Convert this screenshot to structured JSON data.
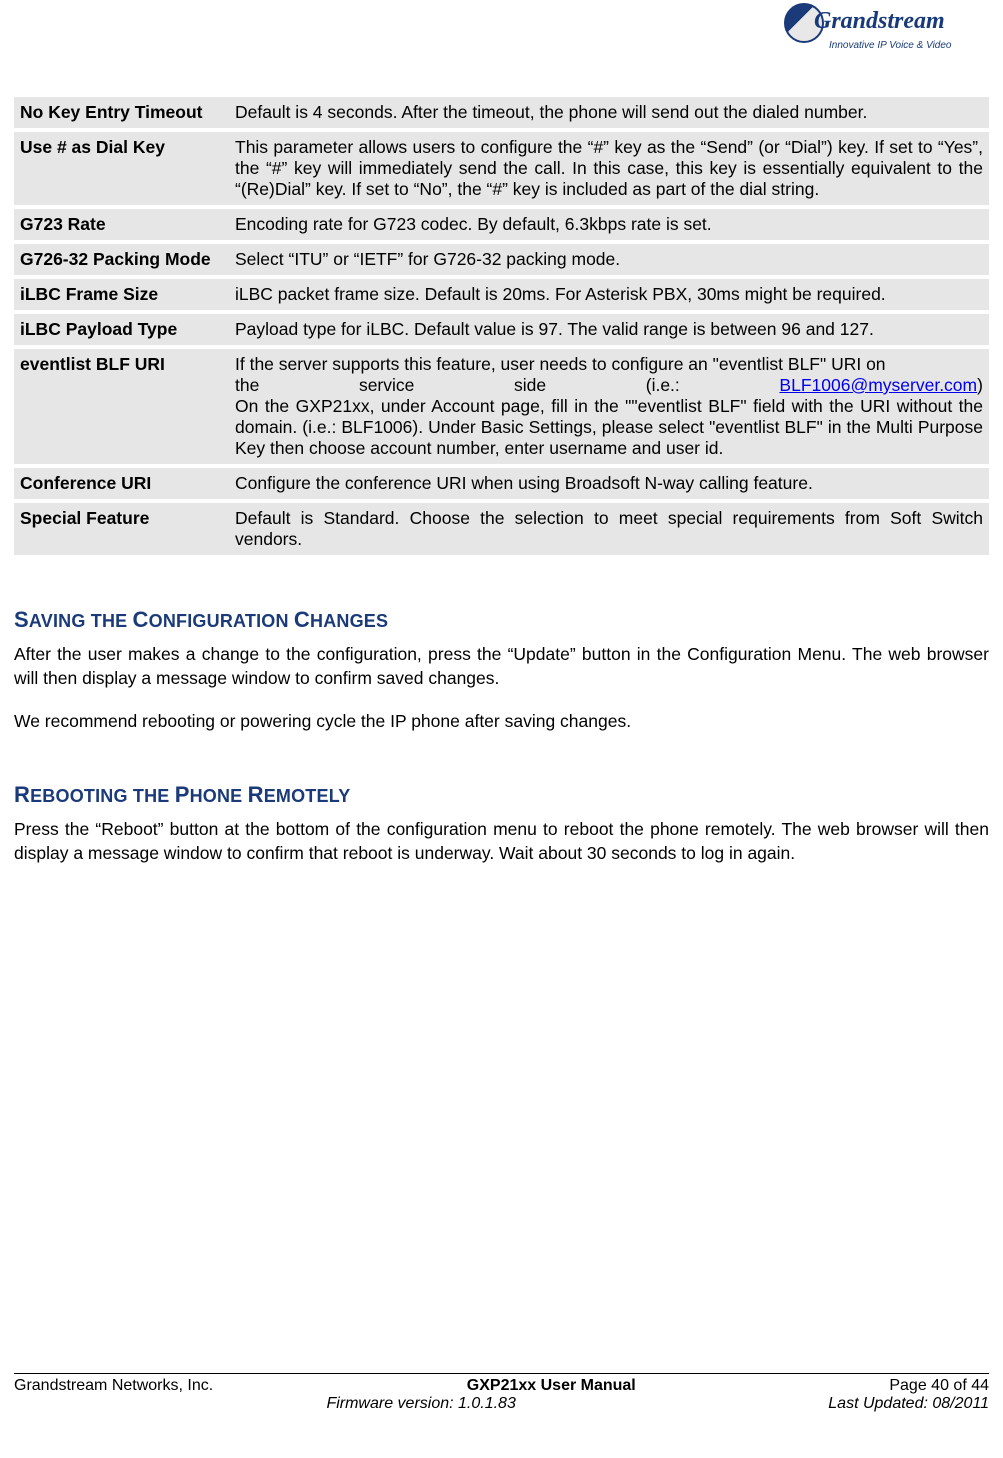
{
  "logo": {
    "brand": "Grandstream",
    "tagline": "Innovative IP Voice & Video"
  },
  "table": [
    {
      "label": "No Key Entry Timeout",
      "desc": "Default is 4 seconds. After the timeout, the phone will send out the dialed number."
    },
    {
      "label": "Use # as Dial Key",
      "desc": "This parameter allows users to configure the “#” key as the “Send” (or “Dial”) key. If set to “Yes”, the “#” key will immediately send the call. In this case, this key is essentially equivalent to the “(Re)Dial” key. If set to “No”, the “#” key is included as part of the dial string."
    },
    {
      "label": "G723 Rate",
      "desc": "Encoding rate for G723 codec. By default, 6.3kbps rate is set."
    },
    {
      "label": "G726-32 Packing Mode",
      "desc": "Select “ITU” or “IETF” for G726-32 packing mode."
    },
    {
      "label": "iLBC Frame Size",
      "desc": "iLBC packet frame size. Default is 20ms. For Asterisk PBX, 30ms might be required."
    },
    {
      "label": "iLBC Payload Type",
      "desc": "Payload type for iLBC. Default value is 97. The valid range is between 96 and 127."
    },
    {
      "label": "eventlist BLF URI",
      "pre": "If the server supports this feature, user needs to configure an \"eventlist BLF\" URI on",
      "line_words": [
        "the",
        "service",
        "side",
        "(i.e.:"
      ],
      "link": "BLF1006@myserver.com",
      "line_end": ")",
      "post": "On the GXP21xx, under Account page, fill in the \"\"eventlist BLF\" field with the URI without the domain. (i.e.: BLF1006). Under Basic Settings, please select \"eventlist BLF\" in the Multi Purpose Key then choose account number, enter username and user id."
    },
    {
      "label": "Conference URI",
      "desc": "Configure the conference URI when using Broadsoft N-way calling feature."
    },
    {
      "label": "Special Feature",
      "desc": "Default is Standard. Choose the selection to meet special requirements from Soft Switch vendors."
    }
  ],
  "sections": {
    "saving": {
      "heading_parts": [
        "S",
        "AVING THE ",
        "C",
        "ONFIGURATION ",
        "C",
        "HANGES"
      ],
      "p1": "After the user makes a change to the configuration, press the “Update” button in the Configuration Menu. The web browser will then display a message window to confirm saved changes.",
      "p2": "We recommend rebooting or powering cycle the IP phone after saving changes."
    },
    "reboot": {
      "heading_parts": [
        "R",
        "EBOOTING THE ",
        "P",
        "HONE ",
        "R",
        "EMOTELY"
      ],
      "p1": "Press the “Reboot” button at the bottom of the configuration menu to reboot the phone remotely. The web browser will then display a message window to confirm that reboot is underway. Wait about 30 seconds to log in again."
    }
  },
  "footer": {
    "left": "Grandstream Networks, Inc.",
    "center1": "GXP21xx User Manual",
    "center2": "Firmware version: 1.0.1.83",
    "right1": "Page 40 of 44",
    "right2": "Last Updated:  08/2011"
  }
}
